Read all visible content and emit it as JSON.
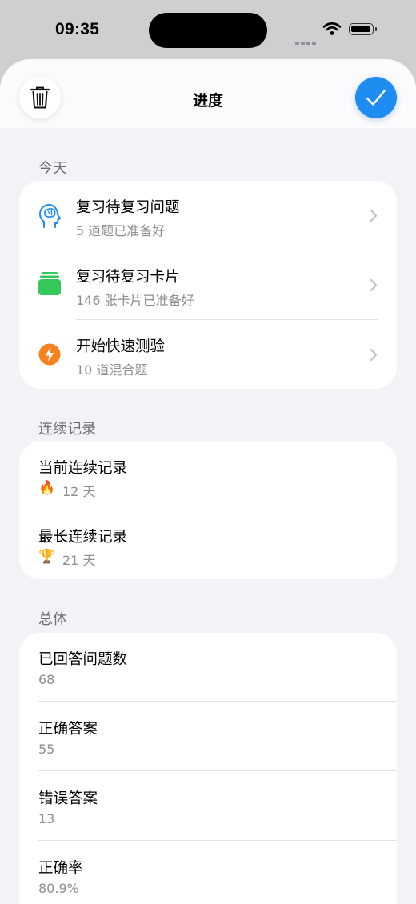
{
  "status_bar": {
    "time": "09:35"
  },
  "header": {
    "title": "进度"
  },
  "sections": {
    "today": {
      "header": "今天",
      "items": [
        {
          "title": "复习待复习问题",
          "subtitle": "5 道题已准备好",
          "icon": "brain-head-icon"
        },
        {
          "title": "复习待复习卡片",
          "subtitle": "146 张卡片已准备好",
          "icon": "card-stack-icon"
        },
        {
          "title": "开始快速测验",
          "subtitle": "10 道混合题",
          "icon": "lightning-icon"
        }
      ]
    },
    "streak": {
      "header": "连续记录",
      "items": [
        {
          "title": "当前连续记录",
          "value": "12 天",
          "emoji": "🔥"
        },
        {
          "title": "最长连续记录",
          "value": "21 天",
          "emoji": "🏆"
        }
      ]
    },
    "overall": {
      "header": "总体",
      "items": [
        {
          "title": "已回答问题数",
          "value": "68"
        },
        {
          "title": "正确答案",
          "value": "55"
        },
        {
          "title": "错误答案",
          "value": "13"
        },
        {
          "title": "正确率",
          "value": "80.9%"
        }
      ]
    }
  },
  "colors": {
    "accent": "#1f8cf2",
    "green": "#34c759",
    "orange": "#f5821f",
    "background": "#f2f2f7"
  }
}
